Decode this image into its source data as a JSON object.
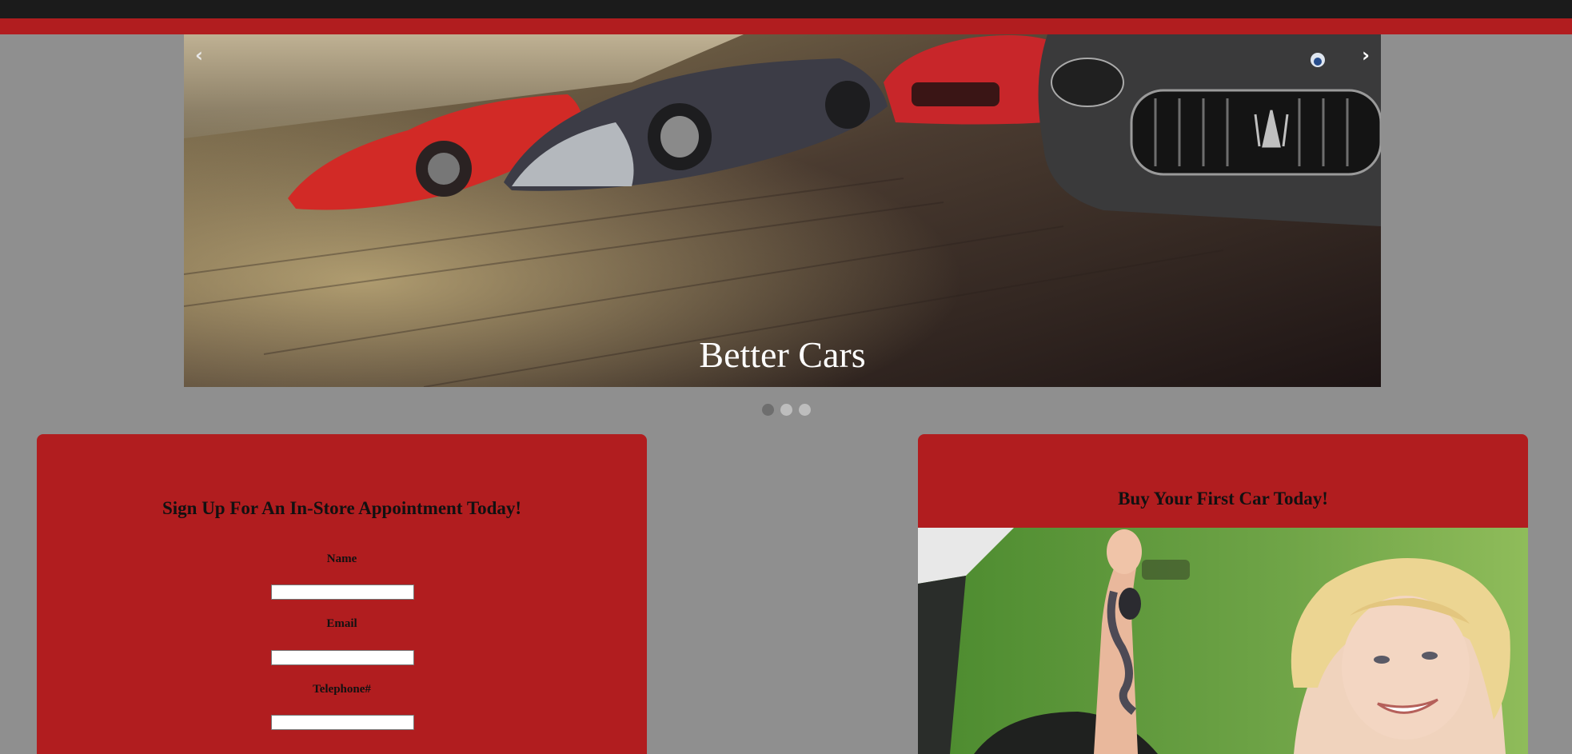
{
  "slideshow": {
    "caption": "Better Cars",
    "prev_symbol": "‹",
    "next_symbol": "›",
    "dots": [
      {
        "active": true
      },
      {
        "active": false
      },
      {
        "active": false
      }
    ]
  },
  "signup": {
    "title": "Sign Up For An In-Store Appointment Today!",
    "fields": [
      {
        "label": "Name",
        "value": ""
      },
      {
        "label": "Email",
        "value": ""
      },
      {
        "label": "Telephone#",
        "value": ""
      }
    ]
  },
  "buy": {
    "title": "Buy Your First Car Today!"
  },
  "colors": {
    "header_dark": "#1b1b1b",
    "brand_red": "#b11d1f",
    "page_gray": "#8f8f8f"
  }
}
